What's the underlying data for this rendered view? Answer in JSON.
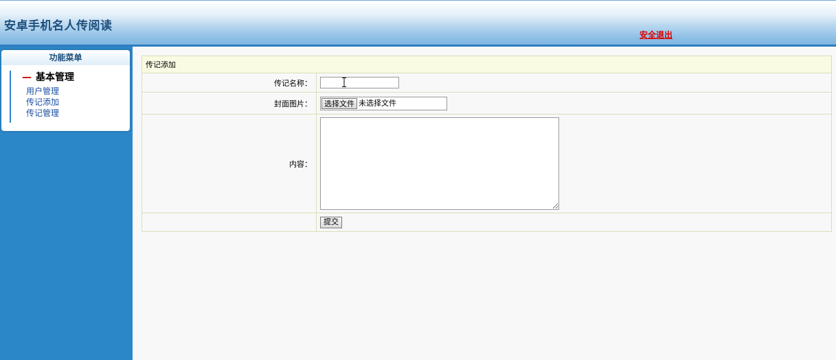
{
  "header": {
    "site_title": "安卓手机名人传阅读",
    "logout_label": "安全退出"
  },
  "sidebar": {
    "menu_title": "功能菜单",
    "group_title": "基本管理",
    "group_marker": "—",
    "items": [
      {
        "label": "用户管理"
      },
      {
        "label": "传记添加"
      },
      {
        "label": "传记管理"
      }
    ]
  },
  "form": {
    "caption": "传记添加",
    "name_label": "传记名称：",
    "name_value": "",
    "cover_label": "封面图片：",
    "file_button_label": "选择文件",
    "file_status": "未选择文件",
    "content_label": "内容：",
    "content_value": "",
    "submit_label": "提交"
  },
  "icons": {
    "text_cursor": "i-beam-cursor-icon"
  }
}
